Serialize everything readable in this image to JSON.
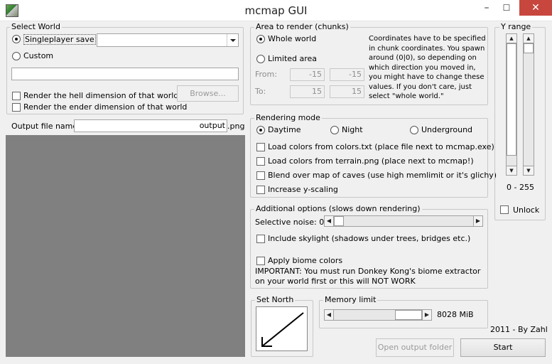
{
  "window": {
    "title": "mcmap GUI",
    "minimize": "–",
    "maximize": "☐",
    "close": "✕"
  },
  "select_world": {
    "title": "Select World",
    "singleplayer_label": "Singleplayer save",
    "singleplayer_selected": true,
    "combo_value": "",
    "custom_label": "Custom",
    "custom_path": "",
    "render_hell_label": "Render the hell dimension of that world",
    "render_ender_label": "Render the ender dimension of that world",
    "browse_label": "Browse..."
  },
  "output": {
    "label": "Output file name",
    "value": "output",
    "suffix": ".png"
  },
  "area": {
    "title": "Area to render (chunks)",
    "whole_world_label": "Whole world",
    "limited_area_label": "Limited area",
    "whole_world_selected": true,
    "from_label": "From:",
    "to_label": "To:",
    "from_x": "-15",
    "from_z": "-15",
    "to_x": "15",
    "to_z": "15",
    "help_text": "Coordinates have to be specified in chunk coordinates. You spawn around (0|0), so depending on which direction you moved in, you might have to change these values. If you don't care, just select \"whole world.\""
  },
  "rendering_mode": {
    "title": "Rendering mode",
    "daytime_label": "Daytime",
    "night_label": "Night",
    "underground_label": "Underground",
    "selected": "daytime",
    "colors_txt_label": "Load colors from colors.txt (place file next to mcmap.exe)",
    "terrain_png_label": "Load colors from terrain.png (place next to mcmap!)",
    "blend_caves_label": "Blend over map of caves (use high memlimit or it's glichy)",
    "y_scaling_label": "Increase y-scaling"
  },
  "additional": {
    "title": "Additional options (slows down rendering)",
    "noise_label": "Selective noise: 0",
    "noise_value": 0,
    "skylight_label": "Include skylight (shadows under trees, bridges etc.)",
    "biome_label": "Apply biome colors",
    "biome_warning": "IMPORTANT: You must run Donkey Kong's biome extractor on your world first or this will NOT WORK"
  },
  "set_north": {
    "title": "Set North"
  },
  "memory": {
    "title": "Memory limit",
    "value_label": "8028 MiB"
  },
  "y_range": {
    "title": "Y range",
    "range_label": "0 - 255",
    "unlock_label": "Unlock"
  },
  "footer": {
    "credit": "2011 - By Zahl",
    "open_output_label": "Open output folder",
    "start_label": "Start"
  }
}
